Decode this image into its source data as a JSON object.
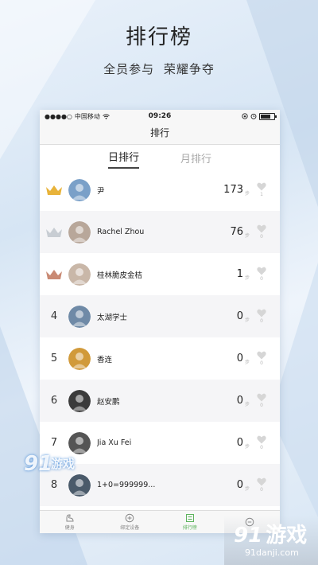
{
  "promo": {
    "title": "排行榜",
    "subtitle": "全员参与 荣耀争夺"
  },
  "status_bar": {
    "carrier": "中国移动",
    "time": "09:26",
    "battery_level": 0.8
  },
  "nav": {
    "title": "排行"
  },
  "tabs": [
    {
      "label": "日排行",
      "active": true
    },
    {
      "label": "月排行",
      "active": false
    }
  ],
  "colors": {
    "gold_crown": "#e8b33a",
    "silver_crown": "#c8cdd3",
    "bronze_crown": "#c98a74",
    "active_tab_green": "#5db35d"
  },
  "unit_label": "步",
  "leaderboard": [
    {
      "rank": "",
      "crown": "gold",
      "name": "尹",
      "score": "173",
      "likes": "1"
    },
    {
      "rank": "",
      "crown": "silver",
      "name": "Rachel Zhou",
      "score": "76",
      "likes": "0"
    },
    {
      "rank": "",
      "crown": "bronze",
      "name": "桂林脆皮金桔",
      "score": "1",
      "likes": "0"
    },
    {
      "rank": "4",
      "crown": "",
      "name": "太湖学士",
      "score": "0",
      "likes": "0"
    },
    {
      "rank": "5",
      "crown": "",
      "name": "香连",
      "score": "0",
      "likes": "0"
    },
    {
      "rank": "6",
      "crown": "",
      "name": "赵安鹏",
      "score": "0",
      "likes": "0"
    },
    {
      "rank": "7",
      "crown": "",
      "name": "Jia Xu Fei",
      "score": "0",
      "likes": "0"
    },
    {
      "rank": "8",
      "crown": "",
      "name": "1+0=999999...",
      "score": "0",
      "likes": "0"
    }
  ],
  "tab_bar": [
    {
      "label": "健身",
      "icon": "arm-icon"
    },
    {
      "label": "绑定设备",
      "icon": "device-icon"
    },
    {
      "label": "排行榜",
      "icon": "ranking-icon",
      "active": true
    },
    {
      "label": "",
      "icon": "profile-icon"
    }
  ],
  "watermark": {
    "left_logo": "91",
    "left_text": "游戏",
    "br_logo_num": "91",
    "br_logo_text": "游戏",
    "br_url": "91danji.com"
  }
}
